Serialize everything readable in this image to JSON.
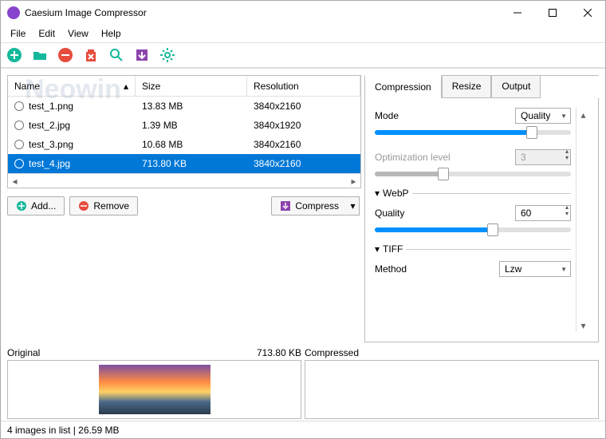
{
  "window": {
    "title": "Caesium Image Compressor"
  },
  "menu": {
    "file": "File",
    "edit": "Edit",
    "view": "View",
    "help": "Help"
  },
  "table": {
    "headers": {
      "name": "Name",
      "size": "Size",
      "resolution": "Resolution"
    },
    "rows": [
      {
        "name": "test_1.png",
        "size": "13.83 MB",
        "resolution": "3840x2160",
        "selected": false
      },
      {
        "name": "test_2.jpg",
        "size": "1.39 MB",
        "resolution": "3840x1920",
        "selected": false
      },
      {
        "name": "test_3.png",
        "size": "10.68 MB",
        "resolution": "3840x2160",
        "selected": false
      },
      {
        "name": "test_4.jpg",
        "size": "713.80 KB",
        "resolution": "3840x2160",
        "selected": true
      }
    ]
  },
  "buttons": {
    "add": "Add...",
    "remove": "Remove",
    "compress": "Compress"
  },
  "tabs": {
    "compression": "Compression",
    "resize": "Resize",
    "output": "Output"
  },
  "compression": {
    "mode_label": "Mode",
    "mode_value": "Quality",
    "quality_slider": 80,
    "opt_label": "Optimization level",
    "opt_value": "3",
    "opt_slider": 35,
    "webp_header": "WebP",
    "webp_quality_label": "Quality",
    "webp_quality_value": "60",
    "webp_slider": 60,
    "tiff_header": "TIFF",
    "method_label": "Method",
    "method_value": "Lzw"
  },
  "preview": {
    "original_label": "Original",
    "original_size": "713.80 KB",
    "compressed_label": "Compressed"
  },
  "status": {
    "text": "4 images in list | 26.59 MB"
  },
  "watermark": "Neowin"
}
